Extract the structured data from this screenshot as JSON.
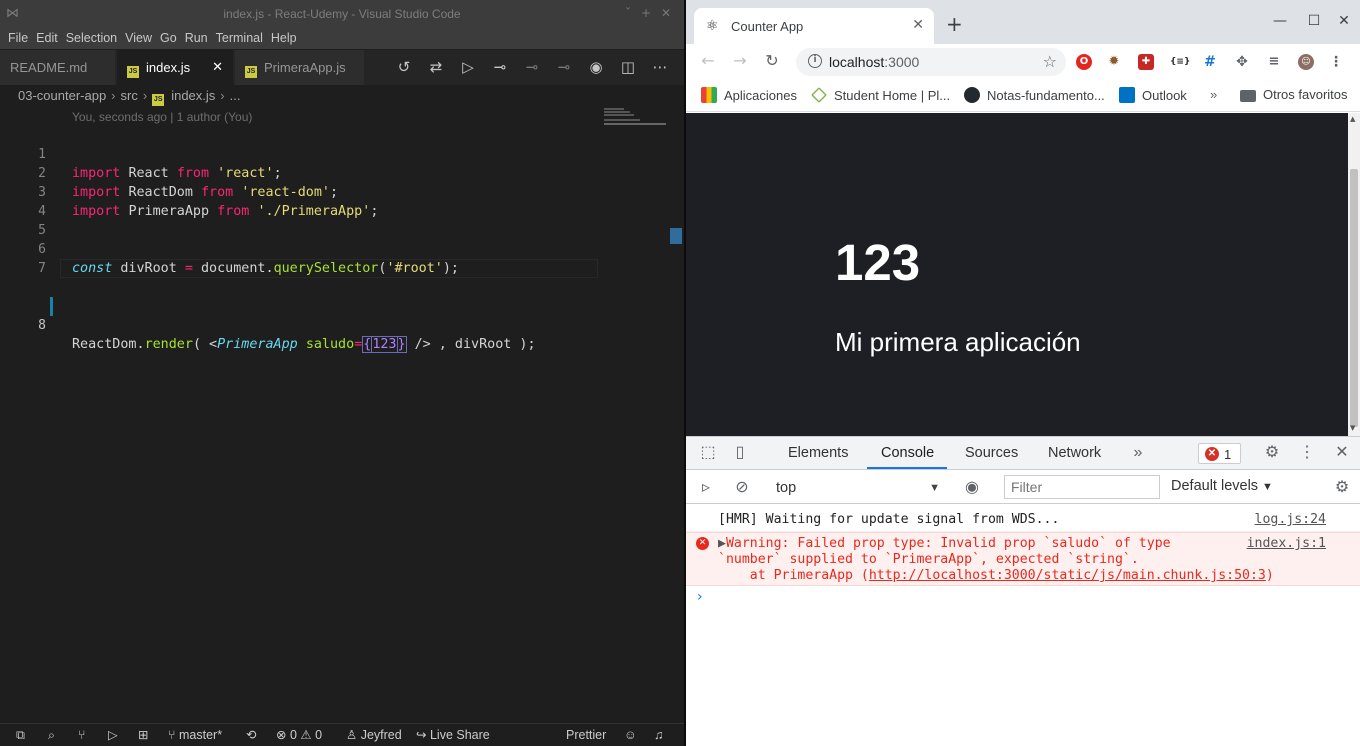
{
  "vscode": {
    "window_title": "index.js - React-Udemy - Visual Studio Code",
    "menu": [
      "File",
      "Edit",
      "Selection",
      "View",
      "Go",
      "Run",
      "Terminal",
      "Help"
    ],
    "tabs": [
      {
        "label": "README.md",
        "active": false
      },
      {
        "label": "index.js",
        "active": true
      },
      {
        "label": "PrimeraApp.js",
        "active": false
      }
    ],
    "breadcrumb": [
      "03-counter-app",
      "src",
      "index.js",
      "..."
    ],
    "blame": "You, seconds ago | 1 author (You)",
    "line_numbers": [
      "1",
      "2",
      "3",
      "4",
      "5",
      "6",
      "7",
      "8"
    ],
    "code": {
      "l1": [
        "import",
        "React",
        "from",
        "'react'",
        ";"
      ],
      "l2": [
        "import",
        "ReactDom",
        "from",
        "'react-dom'",
        ";"
      ],
      "l3": [
        "import",
        "PrimeraApp",
        "from",
        "'./PrimeraApp'",
        ";"
      ],
      "l6": [
        "const",
        "divRoot",
        "=",
        "document",
        ".",
        "querySelector",
        "(",
        "'#root'",
        ");"
      ],
      "l8": [
        "ReactDom",
        ".",
        "render",
        "( <",
        "PrimeraApp",
        "saludo",
        "=",
        "{",
        "123",
        "}",
        " /> , divRoot );"
      ]
    },
    "status": {
      "branch": "master*",
      "errors": "0",
      "warnings": "0",
      "user": "Jeyfred",
      "live_share": "Live Share",
      "formatter": "Prettier"
    }
  },
  "chrome": {
    "tab_title": "Counter App",
    "url_host": "localhost",
    "url_port": ":3000",
    "bookmarks": [
      "Aplicaciones",
      "Student Home | Pl...",
      "Notas-fundamento...",
      "Outlook",
      "Otros favoritos"
    ],
    "page": {
      "heading": "123",
      "subtitle": "Mi primera aplicación"
    },
    "devtools": {
      "tabs": [
        "Elements",
        "Console",
        "Sources",
        "Network"
      ],
      "active_tab": "Console",
      "error_count": "1",
      "context": "top",
      "filter_placeholder": "Filter",
      "levels": "Default levels",
      "messages": {
        "info": {
          "text": "[HMR] Waiting for update signal from WDS...",
          "source": "log.js:24"
        },
        "error": {
          "line1": "Warning: Failed prop type: Invalid prop `saludo` of type",
          "line2": "`number` supplied to `PrimeraApp`, expected `string`.",
          "line3_prefix": "    at PrimeraApp (",
          "line3_link": "http://localhost:3000/static/js/main.chunk.js:50:3",
          "line3_suffix": ")",
          "source": "index.js:1"
        }
      }
    }
  },
  "colors": {
    "vscode_bg": "#1e1e1e",
    "keyword": "#f92672",
    "string": "#e6db74",
    "function": "#a6e22e",
    "number": "#ae81ff",
    "page_bg": "#1e1f24",
    "console_error": "#e8291d",
    "accent_blue": "#1a73e8"
  }
}
